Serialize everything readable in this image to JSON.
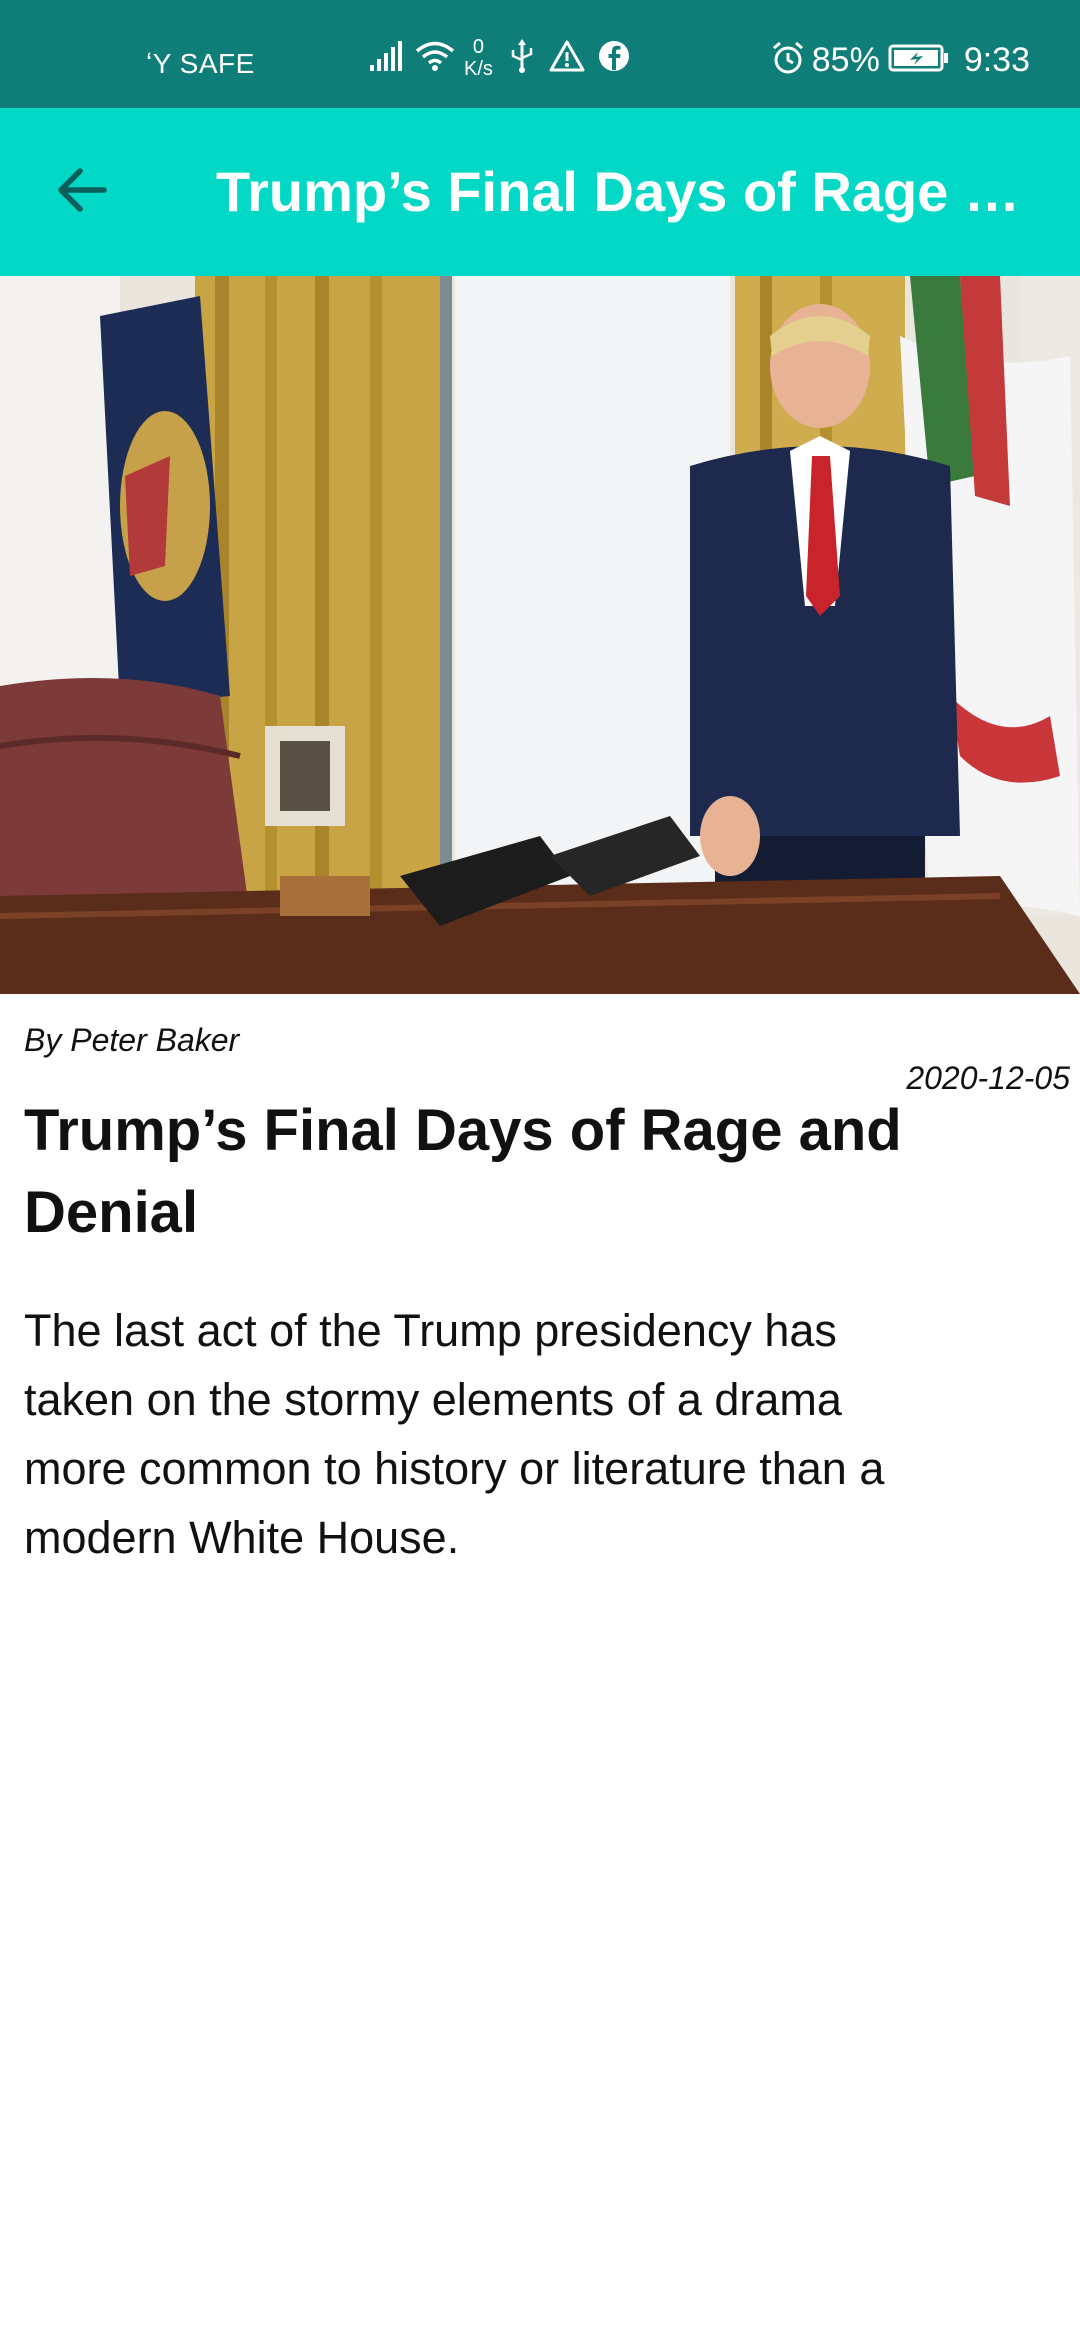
{
  "status_bar": {
    "carrier": "ʻY SAFE",
    "speed_value": "0",
    "speed_unit": "K/s",
    "battery_percent": "85%",
    "time": "9:33",
    "icons": [
      "signal-icon",
      "wifi-icon",
      "usb-icon",
      "warning-icon",
      "facebook-icon",
      "alarm-icon",
      "battery-charging-icon"
    ]
  },
  "app_bar": {
    "title": "Trump’s Final Days of Rage a…",
    "back_icon": "arrow-left-icon",
    "color": "#03d8c6"
  },
  "article": {
    "byline": "By Peter Baker",
    "date": "2020-12-05",
    "headline": "Trump’s Final Days of Rage and Denial",
    "summary": "The last act of the Trump presidency has taken on the stormy elements of a drama more common to history or literature than a modern White House."
  },
  "colors": {
    "status_bar": "#0f7d78",
    "accent": "#03d8c6"
  }
}
